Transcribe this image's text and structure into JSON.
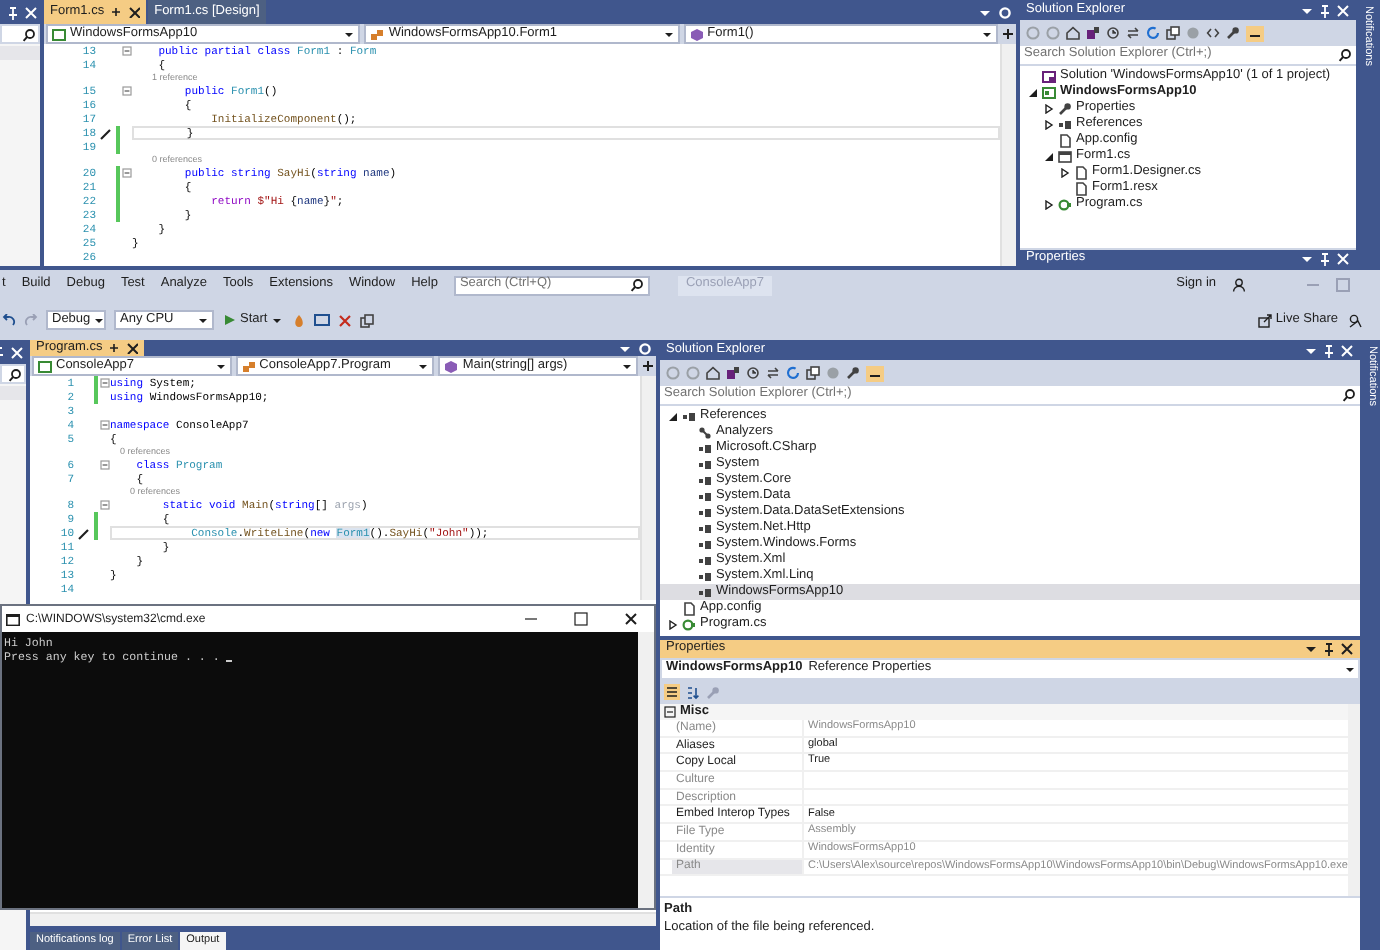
{
  "top_window": {
    "editor_tabs": [
      {
        "label": "Form1.cs",
        "selected": true
      },
      {
        "label": "Form1.cs [Design]",
        "selected": false
      }
    ],
    "navigation": [
      "WindowsFormsApp10",
      "WindowsFormsApp10.Form1",
      "Form1()"
    ],
    "code": [
      {
        "kind": "code",
        "number": "13",
        "foldable": true,
        "changed": false,
        "current": false,
        "tokens": [
          {
            "kind": "kw",
            "text": "    public partial class"
          },
          {
            "kind": "type",
            "text": " Form1"
          },
          {
            "kind": "plain",
            "text": " : "
          },
          {
            "kind": "type",
            "text": "Form"
          }
        ]
      },
      {
        "kind": "code",
        "number": "14",
        "foldable": false,
        "changed": false,
        "current": false,
        "tokens": [
          {
            "kind": "plain",
            "text": "    {"
          }
        ]
      },
      {
        "kind": "hint",
        "text": "        1 reference"
      },
      {
        "kind": "code",
        "number": "15",
        "foldable": true,
        "changed": false,
        "current": false,
        "tokens": [
          {
            "kind": "kw",
            "text": "        public"
          },
          {
            "kind": "type",
            "text": " Form1"
          },
          {
            "kind": "plain",
            "text": "()"
          }
        ]
      },
      {
        "kind": "code",
        "number": "16",
        "foldable": false,
        "changed": false,
        "current": false,
        "tokens": [
          {
            "kind": "plain",
            "text": "        {"
          }
        ]
      },
      {
        "kind": "code",
        "number": "17",
        "foldable": false,
        "changed": false,
        "current": false,
        "tokens": [
          {
            "kind": "method",
            "text": "            InitializeComponent"
          },
          {
            "kind": "plain",
            "text": "();"
          }
        ]
      },
      {
        "kind": "code",
        "number": "18",
        "foldable": false,
        "changed": true,
        "current": true,
        "tokens": [
          {
            "kind": "plain",
            "text": "        }"
          }
        ]
      },
      {
        "kind": "code",
        "number": "19",
        "foldable": false,
        "changed": true,
        "current": false
      },
      {
        "kind": "hint",
        "text": "        0 references"
      },
      {
        "kind": "code",
        "number": "20",
        "foldable": true,
        "changed": true,
        "current": false,
        "tokens": [
          {
            "kind": "kw",
            "text": "        public string"
          },
          {
            "kind": "method",
            "text": " SayHi"
          },
          {
            "kind": "plain",
            "text": "("
          },
          {
            "kind": "kw",
            "text": "string"
          },
          {
            "kind": "param",
            "text": " name"
          },
          {
            "kind": "plain",
            "text": ")"
          }
        ]
      },
      {
        "kind": "code",
        "number": "21",
        "foldable": false,
        "changed": true,
        "current": false,
        "tokens": [
          {
            "kind": "plain",
            "text": "        {"
          }
        ]
      },
      {
        "kind": "code",
        "number": "22",
        "foldable": false,
        "changed": true,
        "current": false,
        "tokens": [
          {
            "kind": "ctrl",
            "text": "            return"
          },
          {
            "kind": "str",
            "text": " $\"Hi "
          },
          {
            "kind": "plain",
            "text": "{"
          },
          {
            "kind": "param",
            "text": "name"
          },
          {
            "kind": "plain",
            "text": "}"
          },
          {
            "kind": "str",
            "text": "\""
          },
          {
            "kind": "plain",
            "text": ";"
          }
        ]
      },
      {
        "kind": "code",
        "number": "23",
        "foldable": false,
        "changed": true,
        "current": false,
        "tokens": [
          {
            "kind": "plain",
            "text": "        }"
          }
        ]
      },
      {
        "kind": "code",
        "number": "24",
        "foldable": false,
        "changed": false,
        "current": false,
        "tokens": [
          {
            "kind": "plain",
            "text": "    }"
          }
        ]
      },
      {
        "kind": "code",
        "number": "25",
        "foldable": false,
        "changed": false,
        "current": false,
        "tokens": [
          {
            "kind": "plain",
            "text": "}"
          }
        ]
      },
      {
        "kind": "code",
        "number": "26",
        "foldable": false,
        "changed": false,
        "current": false
      }
    ],
    "solution_explorer": {
      "title": "Solution Explorer",
      "search_placeholder": "Search Solution Explorer (Ctrl+;)",
      "tree": [
        {
          "label": "Solution 'WindowsFormsApp10' (1 of 1 project)",
          "kind": "solution",
          "bold": false,
          "selected": false
        },
        {
          "label": "WindowsFormsApp10",
          "kind": "project",
          "bold": true,
          "selected": false,
          "expanded": true,
          "children": [
            {
              "label": "Properties",
              "kind": "properties",
              "bold": false,
              "selected": false,
              "expanded": false
            },
            {
              "label": "References",
              "kind": "references",
              "bold": false,
              "selected": false,
              "expanded": false
            },
            {
              "label": "App.config",
              "kind": "config",
              "bold": false,
              "selected": false
            },
            {
              "label": "Form1.cs",
              "kind": "form",
              "bold": false,
              "selected": false,
              "expanded": true,
              "children": [
                {
                  "label": "Form1.Designer.cs",
                  "kind": "file",
                  "bold": false,
                  "selected": false,
                  "expanded": false
                },
                {
                  "label": "Form1.resx",
                  "kind": "file",
                  "bold": false,
                  "selected": false
                }
              ]
            },
            {
              "label": "Program.cs",
              "kind": "csharp",
              "bold": false,
              "selected": false,
              "expanded": false
            }
          ]
        }
      ]
    },
    "properties_title": "Properties",
    "side_tab": "Notifications"
  },
  "main_window": {
    "menu": [
      "t",
      "Build",
      "Debug",
      "Test",
      "Analyze",
      "Tools",
      "Extensions",
      "Window",
      "Help"
    ],
    "search": {
      "placeholder": "Search (Ctrl+Q)"
    },
    "solution_name": "ConsoleApp7",
    "sign_in": "Sign in",
    "toolbar": {
      "configuration": "Debug",
      "platform": "Any CPU",
      "start": "Start",
      "live_share": "Live Share"
    },
    "editor_tabs": [
      {
        "label": "Program.cs",
        "selected": true
      }
    ],
    "navigation": [
      "ConsoleApp7",
      "ConsoleApp7.Program",
      "Main(string[] args)"
    ],
    "code": [
      {
        "kind": "code",
        "number": "1",
        "foldable": true,
        "changed": true,
        "current": false,
        "tokens": [
          {
            "kind": "kw",
            "text": "using"
          },
          {
            "kind": "plain",
            "text": " System;"
          }
        ]
      },
      {
        "kind": "code",
        "number": "2",
        "foldable": false,
        "changed": true,
        "current": false,
        "tokens": [
          {
            "kind": "kw",
            "text": "using"
          },
          {
            "kind": "plain",
            "text": " WindowsFormsApp10;"
          }
        ]
      },
      {
        "kind": "code",
        "number": "3",
        "foldable": false,
        "changed": false,
        "current": false
      },
      {
        "kind": "code",
        "number": "4",
        "foldable": true,
        "changed": false,
        "current": false,
        "tokens": [
          {
            "kind": "kw",
            "text": "namespace"
          },
          {
            "kind": "plain",
            "text": " ConsoleApp7"
          }
        ]
      },
      {
        "kind": "code",
        "number": "5",
        "foldable": false,
        "changed": false,
        "current": false,
        "tokens": [
          {
            "kind": "plain",
            "text": "{"
          }
        ]
      },
      {
        "kind": "hint",
        "text": "    0 references"
      },
      {
        "kind": "code",
        "number": "6",
        "foldable": true,
        "changed": false,
        "current": false,
        "tokens": [
          {
            "kind": "kw",
            "text": "    class"
          },
          {
            "kind": "type",
            "text": " Program"
          }
        ]
      },
      {
        "kind": "code",
        "number": "7",
        "foldable": false,
        "changed": false,
        "current": false,
        "tokens": [
          {
            "kind": "plain",
            "text": "    {"
          }
        ]
      },
      {
        "kind": "hint",
        "text": "        0 references"
      },
      {
        "kind": "code",
        "number": "8",
        "foldable": true,
        "changed": false,
        "current": false,
        "tokens": [
          {
            "kind": "kw",
            "text": "        static void"
          },
          {
            "kind": "method",
            "text": " Main"
          },
          {
            "kind": "plain",
            "text": "("
          },
          {
            "kind": "kw",
            "text": "string"
          },
          {
            "kind": "plain",
            "text": "[] "
          },
          {
            "kind": "unused",
            "text": "args"
          },
          {
            "kind": "plain",
            "text": ")"
          }
        ]
      },
      {
        "kind": "code",
        "number": "9",
        "foldable": false,
        "changed": true,
        "current": false,
        "tokens": [
          {
            "kind": "plain",
            "text": "        {"
          }
        ]
      },
      {
        "kind": "code",
        "number": "10",
        "foldable": false,
        "changed": true,
        "current": true,
        "tokens": [
          {
            "kind": "type",
            "text": "            Console"
          },
          {
            "kind": "plain",
            "text": "."
          },
          {
            "kind": "method",
            "text": "WriteLine"
          },
          {
            "kind": "plain",
            "text": "("
          },
          {
            "kind": "kw",
            "text": "new "
          },
          {
            "kind": "ref",
            "text": "Form1"
          },
          {
            "kind": "plain",
            "text": "()."
          },
          {
            "kind": "method",
            "text": "SayHi"
          },
          {
            "kind": "plain",
            "text": "("
          },
          {
            "kind": "str",
            "text": "\"John\""
          },
          {
            "kind": "plain",
            "text": "));"
          }
        ]
      },
      {
        "kind": "code",
        "number": "11",
        "foldable": false,
        "changed": false,
        "current": false,
        "tokens": [
          {
            "kind": "plain",
            "text": "        }"
          }
        ]
      },
      {
        "kind": "code",
        "number": "12",
        "foldable": false,
        "changed": false,
        "current": false,
        "tokens": [
          {
            "kind": "plain",
            "text": "    }"
          }
        ]
      },
      {
        "kind": "code",
        "number": "13",
        "foldable": false,
        "changed": false,
        "current": false,
        "tokens": [
          {
            "kind": "plain",
            "text": "}"
          }
        ]
      },
      {
        "kind": "code",
        "number": "14",
        "foldable": false,
        "changed": false,
        "current": false
      }
    ],
    "bottom_tabs": [
      {
        "label": "Notifications log",
        "selected": false
      },
      {
        "label": "Error List",
        "selected": false
      },
      {
        "label": "Output",
        "selected": true
      }
    ],
    "solution_explorer": {
      "title": "Solution Explorer",
      "search_placeholder": "Search Solution Explorer (Ctrl+;)",
      "tree": [
        {
          "label": "References",
          "kind": "references",
          "bold": false,
          "selected": false,
          "expanded": true,
          "children": [
            {
              "label": "Analyzers",
              "kind": "analyzers",
              "bold": false,
              "selected": false
            },
            {
              "label": "Microsoft.CSharp",
              "kind": "reference",
              "bold": false,
              "selected": false
            },
            {
              "label": "System",
              "kind": "reference",
              "bold": false,
              "selected": false
            },
            {
              "label": "System.Core",
              "kind": "reference",
              "bold": false,
              "selected": false
            },
            {
              "label": "System.Data",
              "kind": "reference",
              "bold": false,
              "selected": false
            },
            {
              "label": "System.Data.DataSetExtensions",
              "kind": "reference",
              "bold": false,
              "selected": false
            },
            {
              "label": "System.Net.Http",
              "kind": "reference",
              "bold": false,
              "selected": false
            },
            {
              "label": "System.Windows.Forms",
              "kind": "reference",
              "bold": false,
              "selected": false
            },
            {
              "label": "System.Xml",
              "kind": "reference",
              "bold": false,
              "selected": false
            },
            {
              "label": "System.Xml.Linq",
              "kind": "reference",
              "bold": false,
              "selected": false
            },
            {
              "label": "WindowsFormsApp10",
              "kind": "reference",
              "bold": false,
              "selected": true
            }
          ]
        },
        {
          "label": "App.config",
          "kind": "config",
          "bold": false,
          "selected": false
        },
        {
          "label": "Program.cs",
          "kind": "csharp",
          "bold": false,
          "selected": false,
          "expanded": false
        }
      ]
    },
    "properties": {
      "title": "Properties",
      "object": "WindowsFormsApp10",
      "object_type": "Reference Properties",
      "category": "Misc",
      "category_expanded": true,
      "rows": [
        {
          "name": "(Name)",
          "value": "WindowsFormsApp10",
          "disabled": true,
          "selected": false
        },
        {
          "name": "Aliases",
          "value": "global",
          "disabled": false,
          "selected": false
        },
        {
          "name": "Copy Local",
          "value": "True",
          "disabled": false,
          "selected": false
        },
        {
          "name": "Culture",
          "disabled": true,
          "selected": false
        },
        {
          "name": "Description",
          "disabled": true,
          "selected": false
        },
        {
          "name": "Embed Interop Types",
          "value": "False",
          "disabled": false,
          "selected": false
        },
        {
          "name": "File Type",
          "value": "Assembly",
          "disabled": true,
          "selected": false
        },
        {
          "name": "Identity",
          "value": "WindowsFormsApp10",
          "disabled": true,
          "selected": false
        },
        {
          "name": "Path",
          "value": "C:\\Users\\Alex\\source\\repos\\WindowsFormsApp10\\WindowsFormsApp10\\bin\\Debug\\WindowsFormsApp10.exe",
          "disabled": true,
          "selected": true
        }
      ],
      "description_title": "Path",
      "description": "Location of the file being referenced."
    },
    "side_tab": "Notifications"
  },
  "console_window": {
    "title": "C:\\WINDOWS\\system32\\cmd.exe",
    "lines": [
      "Hi John",
      "Press any key to continue . . ."
    ]
  }
}
